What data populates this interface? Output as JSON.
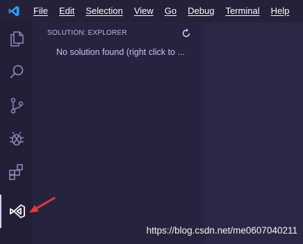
{
  "menubar": {
    "items": [
      "File",
      "Edit",
      "Selection",
      "View",
      "Go",
      "Debug",
      "Terminal",
      "Help"
    ]
  },
  "activitybar": {
    "icons": [
      "explorer-icon",
      "search-icon",
      "source-control-icon",
      "debug-icon",
      "extensions-icon",
      "visual-studio-icon"
    ]
  },
  "sidebar": {
    "header": "SOLUTION: EXPLORER",
    "empty_message": "No solution found (right click to ..."
  },
  "watermark": "https://blog.csdn.net/me0607040211",
  "colors": {
    "menubar_bg": "#242139",
    "activitybar_bg": "#211e36",
    "sidebar_bg": "#26233e",
    "editor_bg": "#2b2845",
    "annotation_arrow": "#e53935",
    "vscode_logo": "#2c9ff0"
  }
}
